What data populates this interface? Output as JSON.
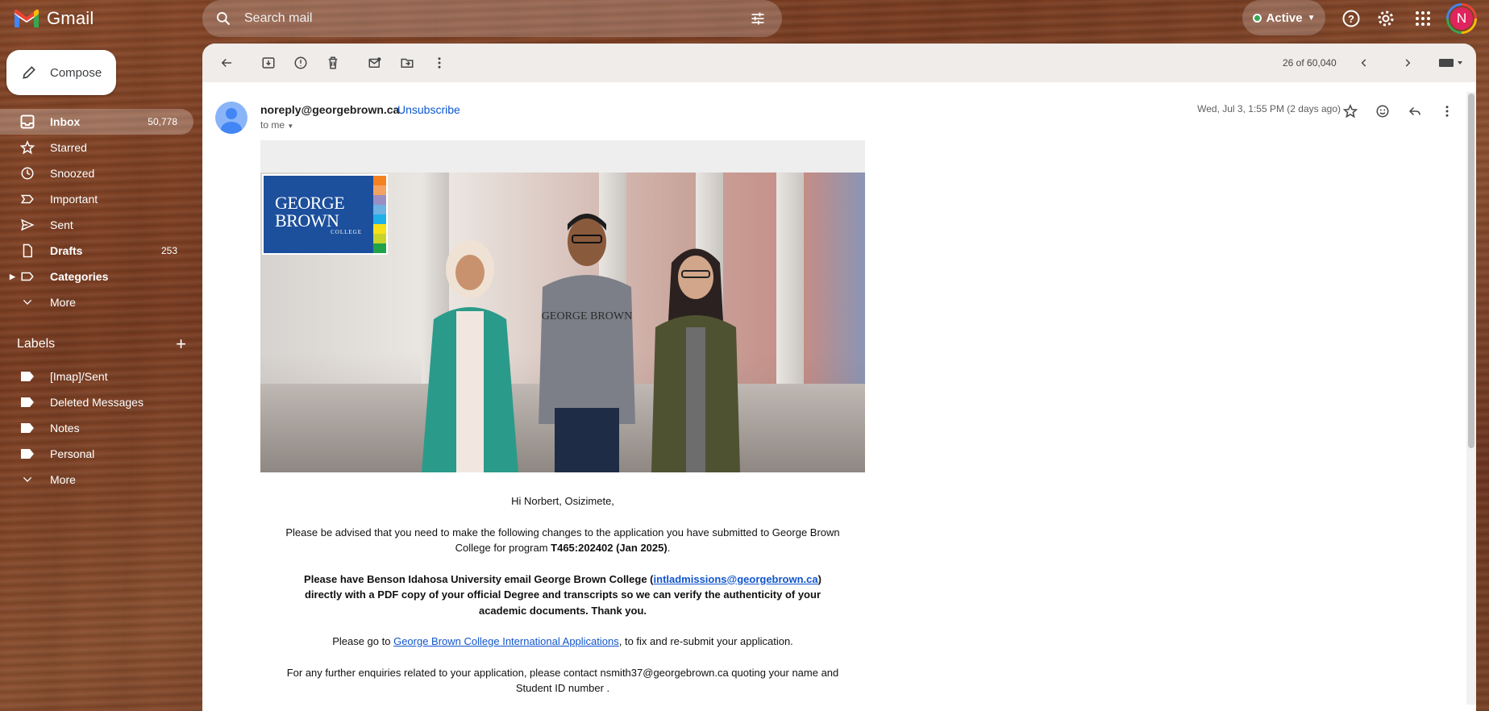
{
  "app": {
    "name": "Gmail"
  },
  "search": {
    "placeholder": "Search mail"
  },
  "status": {
    "label": "Active"
  },
  "account": {
    "initial": "N"
  },
  "sidebar": {
    "compose_label": "Compose",
    "items": [
      {
        "label": "Inbox",
        "count": "50,778",
        "icon": "inbox-icon"
      },
      {
        "label": "Starred",
        "count": "",
        "icon": "star-icon"
      },
      {
        "label": "Snoozed",
        "count": "",
        "icon": "clock-icon"
      },
      {
        "label": "Important",
        "count": "",
        "icon": "important-icon"
      },
      {
        "label": "Sent",
        "count": "",
        "icon": "send-icon"
      },
      {
        "label": "Drafts",
        "count": "253",
        "icon": "draft-icon"
      },
      {
        "label": "Categories",
        "count": "",
        "icon": "label-icon"
      },
      {
        "label": "More",
        "count": "",
        "icon": "chevron-down-icon"
      }
    ],
    "labels_title": "Labels",
    "labels": [
      {
        "label": "[Imap]/Sent"
      },
      {
        "label": "Deleted Messages"
      },
      {
        "label": "Notes"
      },
      {
        "label": "Personal"
      },
      {
        "label": "More"
      }
    ]
  },
  "toolbar": {
    "pager": "26 of 60,040"
  },
  "message": {
    "from": "noreply@georgebrown.ca",
    "unsubscribe": "Unsubscribe",
    "to": "to me",
    "date": "Wed, Jul 3, 1:55 PM (2 days ago)"
  },
  "email": {
    "logo_line1": "GEORGE",
    "logo_line2": "BROWN",
    "logo_line3": "COLLEGE",
    "greeting": "Hi Norbert, Osizimete,",
    "p1_a": "Please be advised that you need to make the following changes to the application you have submitted to George Brown College for program ",
    "p1_program": "T465:202402 (Jan 2025)",
    "p1_end": ".",
    "p2_a": "Please have Benson Idahosa University email George Brown College (",
    "p2_link": "intladmissions@georgebrown.ca",
    "p2_b": ") directly with a PDF copy of your official Degree and transcripts so we can verify the authenticity of your academic documents. Thank you.",
    "p3_a": "Please go to ",
    "p3_link": "George Brown College International Applications",
    "p3_b": ", to fix and re-submit your application.",
    "p4": "For any further enquiries related to your application, please contact nsmith37@georgebrown.ca quoting your name and Student ID number ."
  },
  "colors": {
    "accent": "#0b57d0",
    "logo_blue": "#1c4f9c",
    "active_green": "#34a853"
  }
}
